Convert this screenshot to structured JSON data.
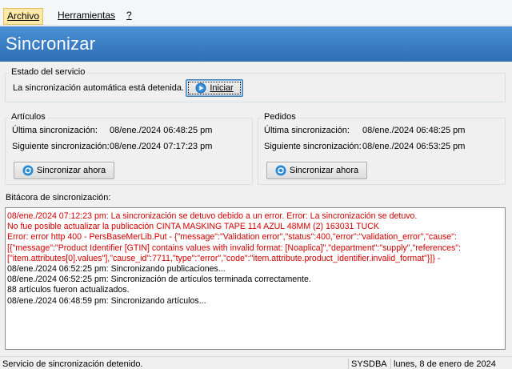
{
  "menu": {
    "archivo": "Archivo",
    "herramientas": "Herramientas",
    "ayuda": "?"
  },
  "header": {
    "title": "Sincronizar"
  },
  "service": {
    "title": "Estado del servicio",
    "status_text": "La sincronización automática está detenida.",
    "start_button": "Iniciar"
  },
  "articles": {
    "title": "Artículos",
    "last_label": "Última sincronización:",
    "last_value": "08/ene./2024 06:48:25 pm",
    "next_label": "Siguiente sincronización:",
    "next_value": "08/ene./2024 07:17:23 pm",
    "sync_button": "Sincronizar ahora"
  },
  "orders": {
    "title": "Pedidos",
    "last_label": "Última sincronización:",
    "last_value": "08/ene./2024 06:48:25 pm",
    "next_label": "Siguiente sincronización:",
    "next_value": "08/ene./2024 06:53:25 pm",
    "sync_button": "Sincronizar ahora"
  },
  "log": {
    "label": "Bitácora de sincronización:",
    "lines": [
      {
        "text": "08/ene./2024 07:12:23 pm: La sincronización se detuvo debido a un error. Error: La sincronización se detuvo.",
        "type": "error"
      },
      {
        "text": "No fue posible actualizar la publicación CINTA MASKING TAPE 114 AZUL 48MM (2) 163031 TUCK",
        "type": "error"
      },
      {
        "text": "Error: error http 400 - PersBaseMerLib.Put - {\"message\":\"Validation error\",\"status\":400,\"error\":\"validation_error\",\"cause\":",
        "type": "error"
      },
      {
        "text": "[{\"message\":\"Product Identifier [GTIN] contains values with invalid format: [Noaplica]\",\"department\":\"supply\",\"references\":",
        "type": "error"
      },
      {
        "text": "[\"item.attributes[0].values\"],\"cause_id\":7711,\"type\":\"error\",\"code\":\"item.attribute.product_identifier.invalid_format\"}]} -",
        "type": "error"
      },
      {
        "text": "08/ene./2024 06:52:25 pm: Sincronizando publicaciones...",
        "type": "normal"
      },
      {
        "text": "08/ene./2024 06:52:25 pm: Sincronización de artículos terminada correctamente.",
        "type": "normal"
      },
      {
        "text": "88 artículos fueron actualizados.",
        "type": "normal"
      },
      {
        "text": "08/ene./2024 06:48:59 pm: Sincronizando artículos...",
        "type": "normal"
      }
    ]
  },
  "status_bar": {
    "message": "Servicio de sincronización detenido.",
    "user": "SYSDBA",
    "date": "lunes, 8 de enero de 2024"
  },
  "colors": {
    "header": "#3a7dc2",
    "error_text": "#d00000",
    "icon_start": "#1e73be",
    "icon_sync": "#2a8ad4"
  }
}
